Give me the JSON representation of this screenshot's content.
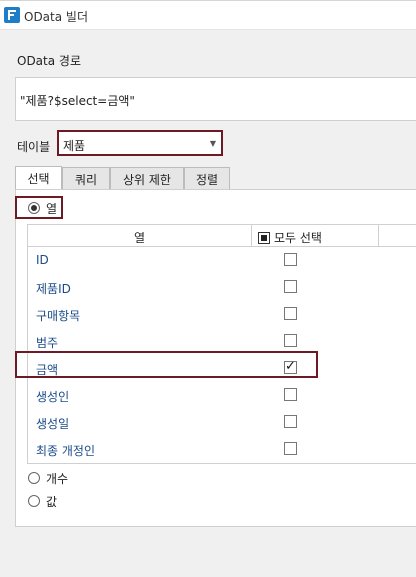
{
  "window": {
    "title": "OData 빌더"
  },
  "path": {
    "label": "OData 경로",
    "value": "\"제품?$select=금액\""
  },
  "table": {
    "label": "테이블",
    "selected": "제품"
  },
  "tabs": [
    {
      "label": "선택",
      "active": true
    },
    {
      "label": "쿼리",
      "active": false
    },
    {
      "label": "상위 제한",
      "active": false
    },
    {
      "label": "정렬",
      "active": false
    }
  ],
  "options": {
    "columns": {
      "label": "열",
      "checked": true
    },
    "count": {
      "label": "개수",
      "checked": false
    },
    "value": {
      "label": "값",
      "checked": false
    }
  },
  "grid": {
    "col_header": "열",
    "select_all": "모두 선택",
    "rows": [
      {
        "name": "ID",
        "checked": false
      },
      {
        "name": "제품ID",
        "checked": false
      },
      {
        "name": "구매항목",
        "checked": false
      },
      {
        "name": "범주",
        "checked": false
      },
      {
        "name": "금액",
        "checked": true
      },
      {
        "name": "생성인",
        "checked": false
      },
      {
        "name": "생성일",
        "checked": false
      },
      {
        "name": "최종 개정인",
        "checked": false
      }
    ]
  },
  "colors": {
    "highlight": "#6b1a26",
    "link_text": "#1c4b8a",
    "app_icon": "#1e7ec8"
  },
  "icons": {
    "app": "odata-app-icon",
    "dropdown": "chevron-down-icon"
  }
}
